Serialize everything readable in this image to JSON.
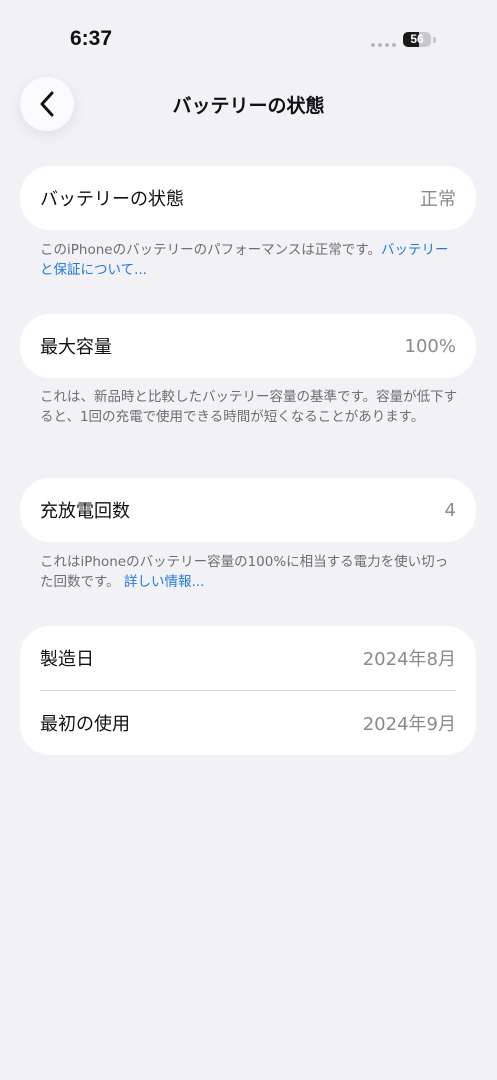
{
  "status_bar": {
    "time": "6:37",
    "battery_level": "56",
    "battery_fraction": 0.56
  },
  "nav": {
    "back_icon": "chevron-left-icon",
    "title": "バッテリーの状態"
  },
  "battery_health": {
    "label": "バッテリーの状態",
    "value": "正常",
    "footnote_text": "このiPhoneのバッテリーのパフォーマンスは正常です。",
    "footnote_link": "バッテリーと保証について..."
  },
  "max_capacity": {
    "label": "最大容量",
    "value": "100%",
    "footnote_text": "これは、新品時と比較したバッテリー容量の基準です。容量が低下すると、1回の充電で使用できる時間が短くなることがあります。"
  },
  "cycle_count": {
    "label": "充放電回数",
    "value": "4",
    "footnote_text": "これはiPhoneのバッテリー容量の100%に相当する電力を使い切った回数です。",
    "footnote_link": "詳しい情報..."
  },
  "dates": {
    "manufacture_label": "製造日",
    "manufacture_value": "2024年8月",
    "first_use_label": "最初の使用",
    "first_use_value": "2024年9月"
  },
  "colors": {
    "background": "#f2f1f6",
    "card": "#ffffff",
    "link": "#1f7ae0",
    "secondary_text": "#8a8a8e"
  }
}
